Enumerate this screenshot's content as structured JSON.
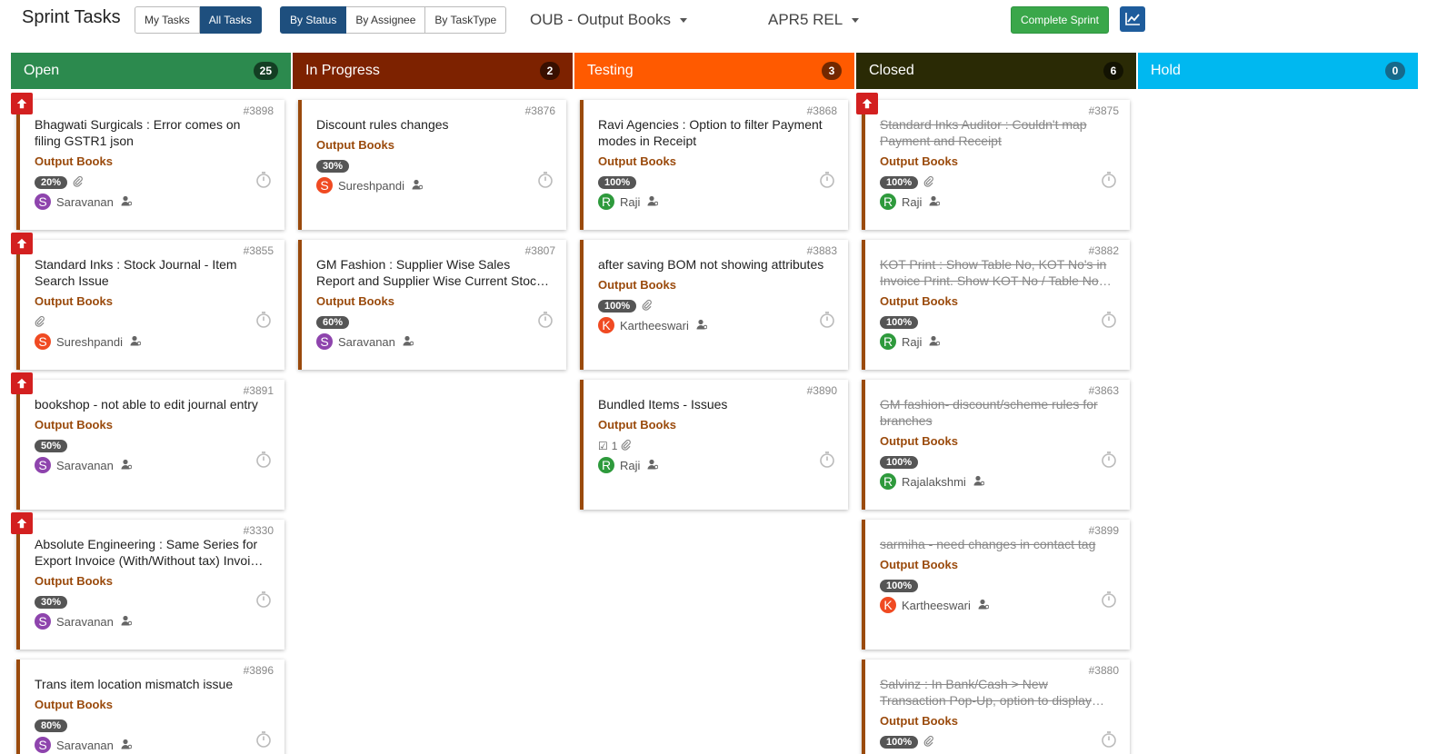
{
  "header": {
    "title": "Sprint Tasks",
    "scope_buttons": [
      "My Tasks",
      "All Tasks"
    ],
    "scope_active": "All Tasks",
    "group_buttons": [
      "By Status",
      "By Assignee",
      "By TaskType"
    ],
    "group_active": "By Status",
    "project": "OUB - Output Books",
    "sprint": "APR5 REL",
    "complete_label": "Complete Sprint",
    "chart_icon": "line-chart-icon"
  },
  "colors": {
    "open": "#2c8a4e",
    "in_progress": "#7d2200",
    "testing": "#ff5a00",
    "closed": "#2a2a05",
    "hold": "#00b8f0",
    "project_text": "#9a4a0c",
    "priority": "#d32020"
  },
  "columns": [
    {
      "name": "Open",
      "count": "25",
      "cards": [
        {
          "id": "#3898",
          "title": "Bhagwati Surgicals : Error comes on filing GSTR1 json",
          "project": "Output Books",
          "progress": "20%",
          "attachment": true,
          "assignee": "Saravanan",
          "initial": "S",
          "avatar_color": "#8e44ad",
          "priority_high": true
        },
        {
          "id": "#3855",
          "title": "Standard Inks : Stock Journal - Item Search Issue",
          "project": "Output Books",
          "progress": "",
          "attachment": true,
          "assignee": "Sureshpandi",
          "initial": "S",
          "avatar_color": "#f04a22",
          "priority_high": true
        },
        {
          "id": "#3891",
          "title": "bookshop - not able to edit journal entry",
          "project": "Output Books",
          "progress": "50%",
          "attachment": false,
          "assignee": "Saravanan",
          "initial": "S",
          "avatar_color": "#8e44ad",
          "priority_high": true
        },
        {
          "id": "#3330",
          "title": "Absolute Engineering : Same Series for Export Invoice (With/Without tax) Invoice Types",
          "project": "Output Books",
          "progress": "30%",
          "attachment": false,
          "assignee": "Saravanan",
          "initial": "S",
          "avatar_color": "#8e44ad",
          "priority_high": true
        },
        {
          "id": "#3896",
          "title": "Trans item location mismatch issue",
          "project": "Output Books",
          "progress": "80%",
          "attachment": false,
          "assignee": "Saravanan",
          "initial": "S",
          "avatar_color": "#8e44ad",
          "priority_high": false
        }
      ]
    },
    {
      "name": "In Progress",
      "count": "2",
      "cards": [
        {
          "id": "#3876",
          "title": "Discount rules changes",
          "project": "Output Books",
          "progress": "30%",
          "attachment": false,
          "assignee": "Sureshpandi",
          "initial": "S",
          "avatar_color": "#f04a22",
          "priority_high": false
        },
        {
          "id": "#3807",
          "title": "GM Fashion : Supplier Wise Sales Report and Supplier Wise Current Stock Report",
          "project": "Output Books",
          "progress": "60%",
          "attachment": false,
          "assignee": "Saravanan",
          "initial": "S",
          "avatar_color": "#8e44ad",
          "priority_high": false
        }
      ]
    },
    {
      "name": "Testing",
      "count": "3",
      "cards": [
        {
          "id": "#3868",
          "title": "Ravi Agencies : Option to filter Payment modes in Receipt",
          "project": "Output Books",
          "progress": "100%",
          "attachment": false,
          "assignee": "Raji",
          "initial": "R",
          "avatar_color": "#2e9a3c",
          "priority_high": false
        },
        {
          "id": "#3883",
          "title": "after saving BOM not showing attributes",
          "project": "Output Books",
          "progress": "100%",
          "attachment": true,
          "assignee": "Kartheeswari",
          "initial": "K",
          "avatar_color": "#f04a22",
          "priority_high": false
        },
        {
          "id": "#3890",
          "title": "Bundled Items - Issues",
          "project": "Output Books",
          "progress": "",
          "checklist": "1",
          "attachment": true,
          "assignee": "Raji",
          "initial": "R",
          "avatar_color": "#2e9a3c",
          "priority_high": false
        }
      ]
    },
    {
      "name": "Closed",
      "count": "6",
      "cards": [
        {
          "id": "#3875",
          "title": "Standard Inks Auditor : Couldn't map Payment and Receipt",
          "project": "Output Books",
          "progress": "100%",
          "attachment": true,
          "assignee": "Raji",
          "initial": "R",
          "avatar_color": "#2e9a3c",
          "priority_high": true
        },
        {
          "id": "#3882",
          "title": "KOT Print : Show Table No, KOT No's in Invoice Print. Show KOT No / Table No in Invoice",
          "project": "Output Books",
          "progress": "100%",
          "attachment": false,
          "assignee": "Raji",
          "initial": "R",
          "avatar_color": "#2e9a3c",
          "priority_high": false
        },
        {
          "id": "#3863",
          "title": "GM fashion- discount/scheme rules for branches",
          "project": "Output Books",
          "progress": "100%",
          "attachment": false,
          "assignee": "Rajalakshmi",
          "initial": "R",
          "avatar_color": "#2e9a3c",
          "priority_high": false
        },
        {
          "id": "#3899",
          "title": "sarmiha - need changes in contact tag",
          "project": "Output Books",
          "progress": "100%",
          "attachment": false,
          "assignee": "Kartheeswari",
          "initial": "K",
          "avatar_color": "#f04a22",
          "priority_high": false
        },
        {
          "id": "#3880",
          "title": "Salvinz : In Bank/Cash > New Transaction Pop-Up, option to display balances",
          "project": "Output Books",
          "progress": "100%",
          "attachment": true,
          "assignee": "",
          "initial": "",
          "avatar_color": "#2e9a3c",
          "priority_high": false
        }
      ]
    },
    {
      "name": "Hold",
      "count": "0",
      "cards": []
    }
  ]
}
